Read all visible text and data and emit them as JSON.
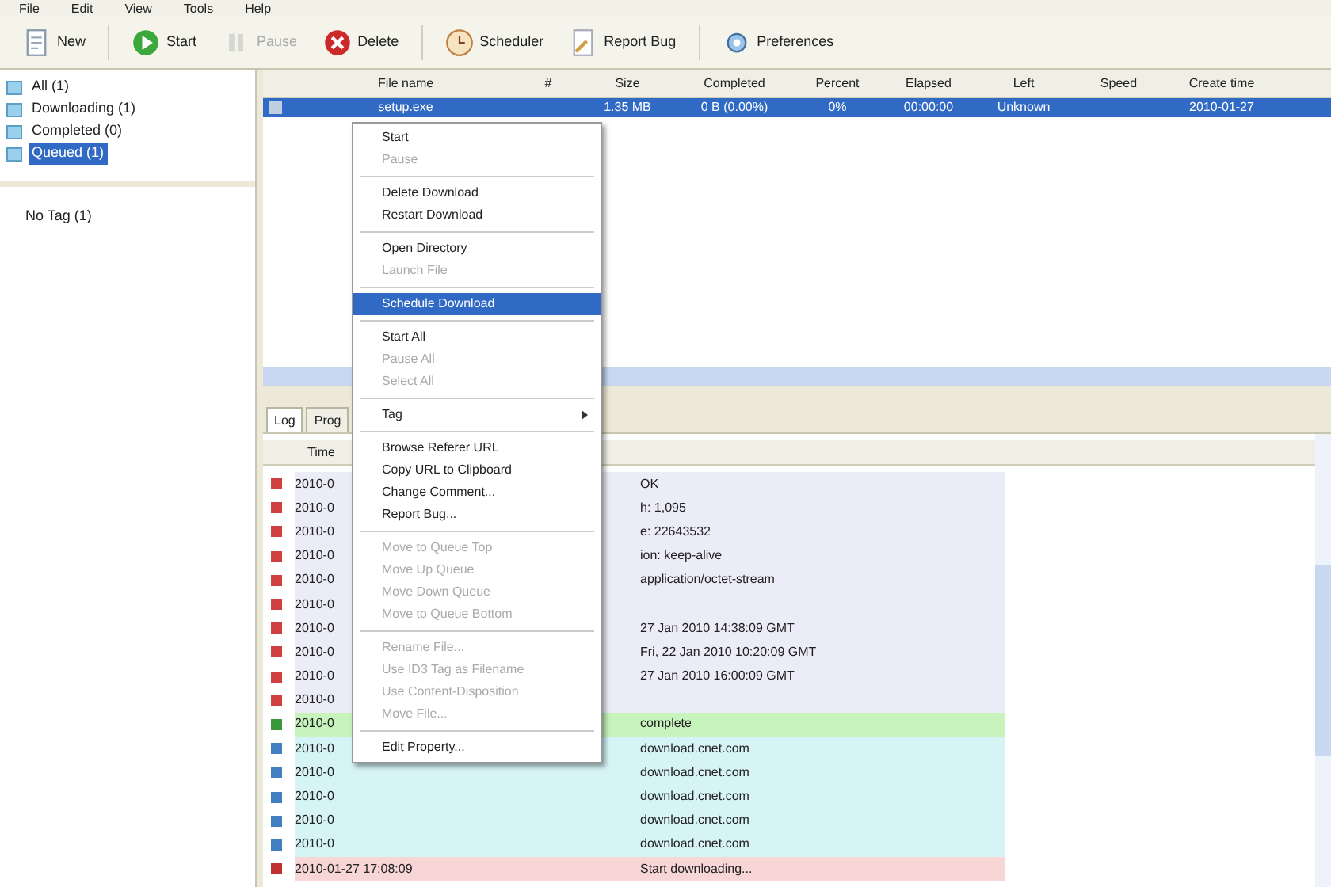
{
  "menu_bar": [
    "File",
    "Edit",
    "View",
    "Tools",
    "Help"
  ],
  "toolbar": [
    {
      "label": "New",
      "disabled": false,
      "kind": "new"
    },
    {
      "label": "Start",
      "disabled": false,
      "kind": "start"
    },
    {
      "label": "Pause",
      "disabled": true,
      "kind": "pause"
    },
    {
      "label": "Delete",
      "disabled": false,
      "kind": "delete"
    },
    {
      "label": "Scheduler",
      "disabled": false,
      "kind": "scheduler"
    },
    {
      "label": "Report Bug",
      "disabled": false,
      "kind": "bug"
    },
    {
      "label": "Preferences",
      "disabled": false,
      "kind": "prefs"
    }
  ],
  "sidebar": {
    "items": [
      {
        "label": "All (1)",
        "selected": false
      },
      {
        "label": "Downloading (1)",
        "selected": false
      },
      {
        "label": "Completed (0)",
        "selected": false
      },
      {
        "label": "Queued (1)",
        "selected": true
      }
    ],
    "tags": [
      "No Tag (1)"
    ]
  },
  "table": {
    "columns": [
      "File name",
      "#",
      "Size",
      "Completed",
      "Percent",
      "Elapsed",
      "Left",
      "Speed",
      "Create time"
    ],
    "rows": [
      {
        "cells": [
          "setup.exe",
          "",
          "1.35 MB",
          "0 B (0.00%)",
          "0%",
          "00:00:00",
          "Unknown",
          "",
          "2010-01-27"
        ],
        "selected": true
      }
    ]
  },
  "context_menu": [
    {
      "label": "Start",
      "disabled": false,
      "selected": false
    },
    {
      "label": "Pause",
      "disabled": true,
      "selected": false
    },
    {
      "kind": "separator"
    },
    {
      "label": "Delete Download",
      "disabled": false,
      "selected": false
    },
    {
      "label": "Restart Download",
      "disabled": false,
      "selected": false
    },
    {
      "kind": "separator"
    },
    {
      "label": "Open Directory",
      "disabled": false,
      "selected": false
    },
    {
      "label": "Launch File",
      "disabled": true,
      "selected": false
    },
    {
      "kind": "separator"
    },
    {
      "label": "Schedule Download",
      "disabled": false,
      "selected": true
    },
    {
      "kind": "separator"
    },
    {
      "label": "Start All",
      "disabled": false,
      "selected": false
    },
    {
      "label": "Pause All",
      "disabled": true,
      "selected": false
    },
    {
      "label": "Select All",
      "disabled": true,
      "selected": false
    },
    {
      "kind": "separator"
    },
    {
      "label": "Tag",
      "disabled": false,
      "selected": false,
      "submenu": true
    },
    {
      "kind": "separator"
    },
    {
      "label": "Browse Referer URL",
      "disabled": false,
      "selected": false
    },
    {
      "label": "Copy URL to Clipboard",
      "disabled": false,
      "selected": false
    },
    {
      "label": "Change Comment...",
      "disabled": false,
      "selected": false
    },
    {
      "label": "Report Bug...",
      "disabled": false,
      "selected": false
    },
    {
      "kind": "separator"
    },
    {
      "label": "Move to Queue Top",
      "disabled": true,
      "selected": false
    },
    {
      "label": "Move Up Queue",
      "disabled": true,
      "selected": false
    },
    {
      "label": "Move Down Queue",
      "disabled": true,
      "selected": false
    },
    {
      "label": "Move to Queue Bottom",
      "disabled": true,
      "selected": false
    },
    {
      "kind": "separator"
    },
    {
      "label": "Rename File...",
      "disabled": true,
      "selected": false
    },
    {
      "label": "Use ID3 Tag as Filename",
      "disabled": true,
      "selected": false
    },
    {
      "label": "Use Content-Disposition",
      "disabled": true,
      "selected": false
    },
    {
      "label": "Move File...",
      "disabled": true,
      "selected": false
    },
    {
      "kind": "separator"
    },
    {
      "label": "Edit Property...",
      "disabled": false,
      "selected": false
    }
  ],
  "bottom_tabs": [
    {
      "label": "Log",
      "selected": true
    },
    {
      "label": "Prog",
      "selected": false
    }
  ],
  "log": {
    "columns": [
      "Time"
    ],
    "rows": [
      {
        "time": "2010-0",
        "message": "OK",
        "color": "#d04040",
        "kind": "header"
      },
      {
        "time": "2010-0",
        "message": "h: 1,095",
        "color": "#d04040",
        "kind": "header"
      },
      {
        "time": "2010-0",
        "message": "e: 22643532",
        "color": "#d04040",
        "kind": "header"
      },
      {
        "time": "2010-0",
        "message": "ion: keep-alive",
        "color": "#d04040",
        "kind": "header"
      },
      {
        "time": "2010-0",
        "message": "application/octet-stream",
        "color": "#d04040",
        "kind": "header"
      },
      {
        "time": "2010-0",
        "message": "",
        "color": "#d04040",
        "kind": "header"
      },
      {
        "time": "2010-0",
        "message": "27 Jan 2010 14:38:09 GMT",
        "color": "#d04040",
        "kind": "header"
      },
      {
        "time": "2010-0",
        "message": "Fri, 22 Jan 2010 10:20:09 GMT",
        "color": "#d04040",
        "kind": "header"
      },
      {
        "time": "2010-0",
        "message": "27 Jan 2010 16:00:09 GMT",
        "color": "#d04040",
        "kind": "header"
      },
      {
        "time": "2010-0",
        "message": "",
        "color": "#d04040",
        "kind": "header"
      },
      {
        "time": "2010-0",
        "message": "complete",
        "color": "#3a9a3a",
        "kind": "success"
      },
      {
        "time": "2010-0",
        "message": "download.cnet.com",
        "color": "#4080c0",
        "kind": "info"
      },
      {
        "time": "2010-0",
        "message": "download.cnet.com",
        "color": "#4080c0",
        "kind": "info"
      },
      {
        "time": "2010-0",
        "message": "download.cnet.com",
        "color": "#4080c0",
        "kind": "info"
      },
      {
        "time": "2010-0",
        "message": "download.cnet.com",
        "color": "#4080c0",
        "kind": "info"
      },
      {
        "time": "2010-0",
        "message": "download.cnet.com",
        "color": "#4080c0",
        "kind": "info"
      },
      {
        "time": "2010-01-27 17:08:09",
        "message": "Start downloading...",
        "color": "#c03030",
        "kind": "error"
      }
    ]
  }
}
